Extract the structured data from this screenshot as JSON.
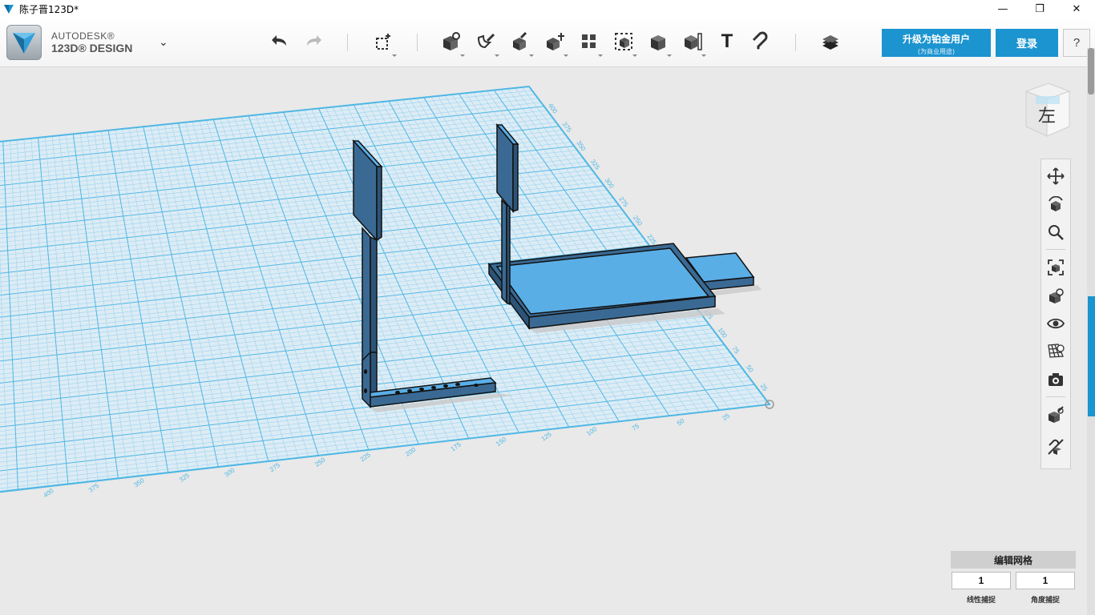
{
  "window": {
    "title": "陈子晋123D*",
    "minimize_label": "—",
    "restore_label": "❐",
    "close_label": "✕"
  },
  "brand": {
    "line1": "AUTODESK®",
    "line2": "123D® DESIGN",
    "menu_caret": "⌄"
  },
  "toolbar": {
    "tools": [
      "undo-icon",
      "redo-icon",
      "primitives-icon",
      "sketch-icon",
      "construct-icon",
      "modify-icon",
      "pattern-icon",
      "group-icon",
      "combine-icon",
      "measure-icon",
      "text-icon",
      "snap-icon",
      "material-icon"
    ],
    "text_tool_glyph": "T",
    "upgrade": {
      "label": "升级为铂金用户",
      "sublabel": "(为商业用途)"
    },
    "login_label": "登录",
    "help_label": "?"
  },
  "viewcube": {
    "face_label": "左"
  },
  "nav_tools": [
    "pan-icon",
    "orbit-icon",
    "zoom-icon",
    "fit-icon",
    "perspective-icon",
    "visibility-icon",
    "grid-icon",
    "screenshot-icon",
    "material-icon",
    "hide-icon"
  ],
  "grid_edit": {
    "title": "编辑网格",
    "linear_snap_value": "1",
    "angle_snap_value": "1",
    "linear_snap_label": "线性捕捉",
    "angle_snap_label": "角度捕捉"
  },
  "grid_ruler_labels": [
    "25",
    "50",
    "75",
    "100",
    "125",
    "150",
    "175",
    "200",
    "225",
    "250",
    "275",
    "300",
    "325",
    "350",
    "375",
    "400"
  ],
  "colors": {
    "accent": "#1b94cf",
    "model_top": "#5aaee6",
    "model_side": "#3a6a93",
    "grid_minor": "#9fd3ee",
    "grid_major": "#4fb7e4"
  }
}
